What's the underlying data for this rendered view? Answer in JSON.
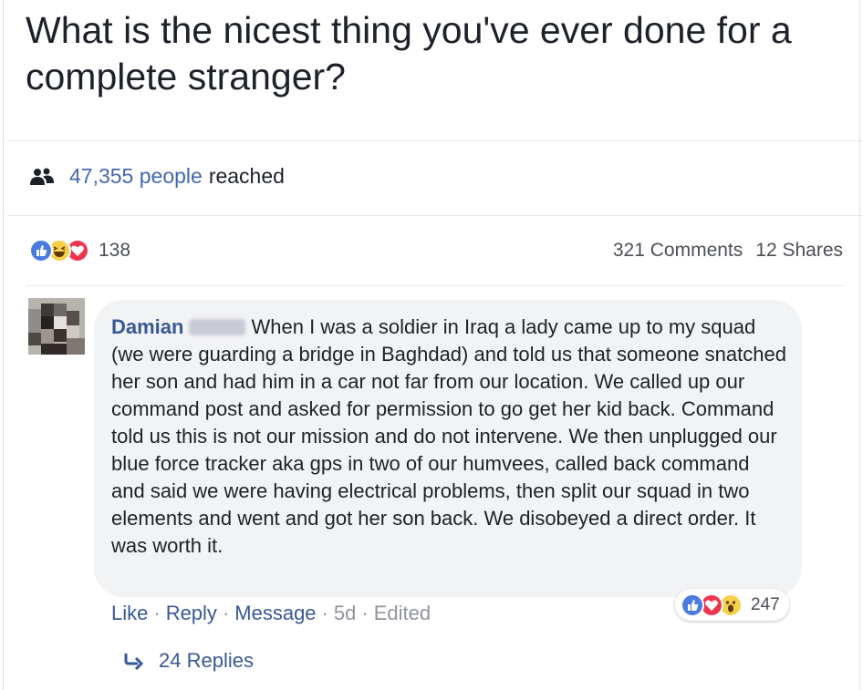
{
  "post": {
    "question": "What is the nicest thing you've ever done for a complete stranger?"
  },
  "reach": {
    "count": "47,355 people",
    "label": "reached",
    "icon": "people-icon"
  },
  "reactions": {
    "icons": [
      "like-reaction-icon",
      "haha-reaction-icon",
      "love-reaction-icon"
    ],
    "count": "138",
    "comments": "321 Comments",
    "shares": "12 Shares"
  },
  "comment": {
    "author": "Damian",
    "text": "When I was a soldier in Iraq a lady came up to my squad (we were guarding a bridge in Baghdad) and told us that someone snatched her son and had him in a car not far from our location. We called up our command post and asked for permission to go get her kid back. Command told us this is not our mission and do not intervene. We then unplugged our blue force tracker aka gps in two of our humvees, called back command and said we were having electrical problems, then split our squad in two elements and went and got her son back. We disobeyed a direct order. It was worth it.",
    "actions": {
      "like": "Like",
      "reply": "Reply",
      "message": "Message",
      "time": "5d",
      "edited": "Edited",
      "separator": "·"
    },
    "reaction_count": "247",
    "reaction_icons": [
      "like-reaction-icon",
      "love-reaction-icon",
      "wow-reaction-icon"
    ]
  },
  "replies": {
    "label": "24 Replies",
    "icon": "reply-arrow-icon"
  },
  "colors": {
    "link": "#385898",
    "reach_link": "#4267b2",
    "like": "#4a7bde",
    "haha": "#f7d04b",
    "love": "#f0354f",
    "bubble": "#f2f3f5"
  }
}
